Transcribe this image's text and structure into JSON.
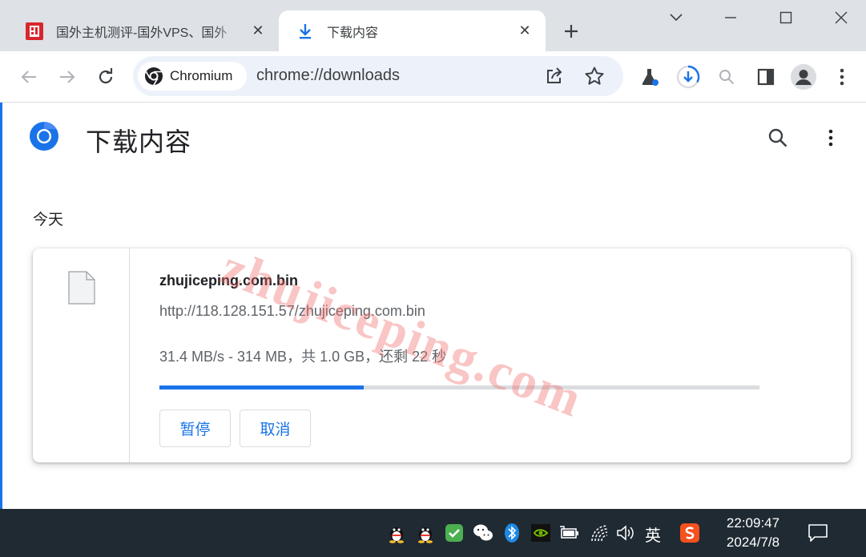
{
  "tabs": [
    {
      "title": "国外主机测评-国外VPS、国外",
      "favicon": "site-logo",
      "close": "✕"
    },
    {
      "title": "下载内容",
      "favicon": "download-icon",
      "close": "✕"
    }
  ],
  "new_tab": "+",
  "omnibox": {
    "chip_label": "Chromium",
    "url": "chrome://downloads"
  },
  "page": {
    "title": "下载内容",
    "section_date": "今天",
    "watermark": "zhujiceping.com"
  },
  "download": {
    "file_name": "zhujiceping.com.bin",
    "url": "http://118.128.151.57/zhujiceping.com.bin",
    "status": "31.4 MB/s - 314 MB，共 1.0 GB，还剩 22 秒",
    "progress_percent": 34,
    "pause_label": "暂停",
    "cancel_label": "取消"
  },
  "taskbar": {
    "ime_label": "英",
    "time": "22:09:47",
    "date": "2024/7/8"
  },
  "colors": {
    "accent": "#1a73e8",
    "tabstrip": "#dee1e6",
    "omnibox": "#edf2fa",
    "taskbar": "#1f2a32"
  }
}
